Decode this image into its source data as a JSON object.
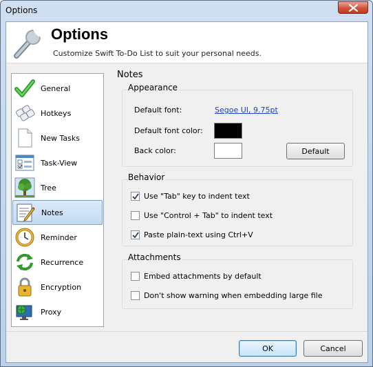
{
  "window": {
    "title": "Options"
  },
  "header": {
    "title": "Options",
    "subtitle": "Customize Swift To-Do List to suit your personal needs.",
    "icon": "wrench-icon"
  },
  "sidebar": {
    "items": [
      {
        "label": "General",
        "icon": "checkmark-icon"
      },
      {
        "label": "Hotkeys",
        "icon": "keyboard-icon"
      },
      {
        "label": "New Tasks",
        "icon": "document-icon"
      },
      {
        "label": "Task-View",
        "icon": "task-view-icon"
      },
      {
        "label": "Tree",
        "icon": "tree-icon"
      },
      {
        "label": "Notes",
        "icon": "notes-icon",
        "selected": true
      },
      {
        "label": "Reminder",
        "icon": "clock-icon"
      },
      {
        "label": "Recurrence",
        "icon": "recurrence-arrows-icon"
      },
      {
        "label": "Encryption",
        "icon": "lock-icon"
      },
      {
        "label": "Proxy",
        "icon": "monitor-globe-icon"
      }
    ]
  },
  "main": {
    "title": "Notes",
    "appearance": {
      "title": "Appearance",
      "font_label": "Default font:",
      "font_value": "Segoe UI, 9.75pt",
      "font_color_label": "Default font color:",
      "font_color": "#000000",
      "back_color_label": "Back color:",
      "back_color": "#ffffff",
      "default_button": "Default"
    },
    "behavior": {
      "title": "Behavior",
      "options": [
        {
          "label": "Use \"Tab\" key to indent text",
          "checked": true
        },
        {
          "label": "Use \"Control + Tab\" to indent text",
          "checked": false
        },
        {
          "label": "Paste plain-text using Ctrl+V",
          "checked": true
        }
      ]
    },
    "attachments": {
      "title": "Attachments",
      "options": [
        {
          "label": "Embed attachments by default",
          "checked": false
        },
        {
          "label": "Don't show warning when embedding large file",
          "checked": false
        }
      ]
    }
  },
  "footer": {
    "ok_label": "OK",
    "cancel_label": "Cancel"
  }
}
